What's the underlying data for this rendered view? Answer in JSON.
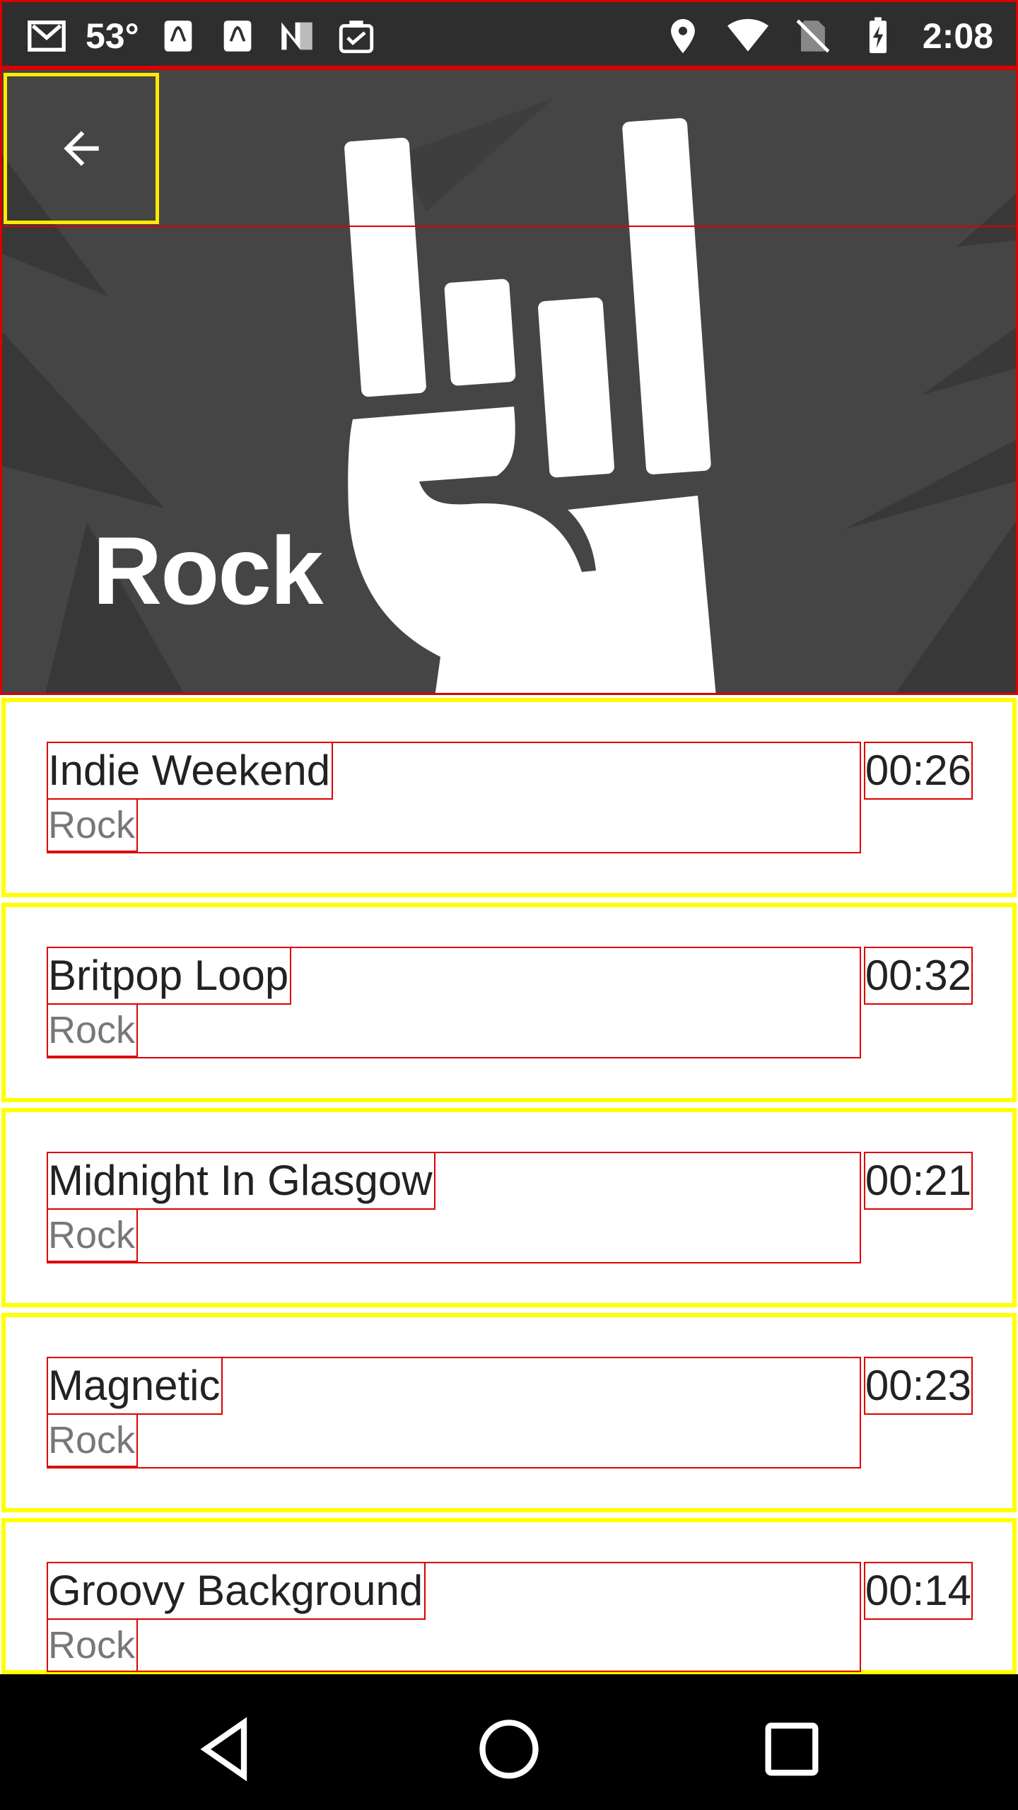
{
  "status_bar": {
    "temperature": "53°",
    "time": "2:08",
    "left_icons": [
      "gmail-icon",
      "huawei-icon",
      "huawei-icon",
      "n-logo-icon",
      "clipboard-check-icon"
    ],
    "right_icons": [
      "location-icon",
      "wifi-icon",
      "no-sim-icon",
      "battery-charging-icon"
    ]
  },
  "header": {
    "title": "Rock",
    "back_icon": "arrow-back-icon"
  },
  "tracks": [
    {
      "title": "Indie Weekend",
      "genre": "Rock",
      "duration": "00:26"
    },
    {
      "title": "Britpop Loop",
      "genre": "Rock",
      "duration": "00:32"
    },
    {
      "title": "Midnight In Glasgow",
      "genre": "Rock",
      "duration": "00:21"
    },
    {
      "title": "Magnetic",
      "genre": "Rock",
      "duration": "00:23"
    },
    {
      "title": "Groovy Background",
      "genre": "Rock",
      "duration": "00:14"
    }
  ],
  "nav_bar": {
    "icons": [
      "back-triangle-icon",
      "home-circle-icon",
      "recents-square-icon"
    ]
  },
  "colors": {
    "statusbar_bg": "#2e2e2e",
    "hero_bg": "#454545",
    "highlight_yellow": "#ffff00",
    "outline_red": "#dd0000"
  }
}
